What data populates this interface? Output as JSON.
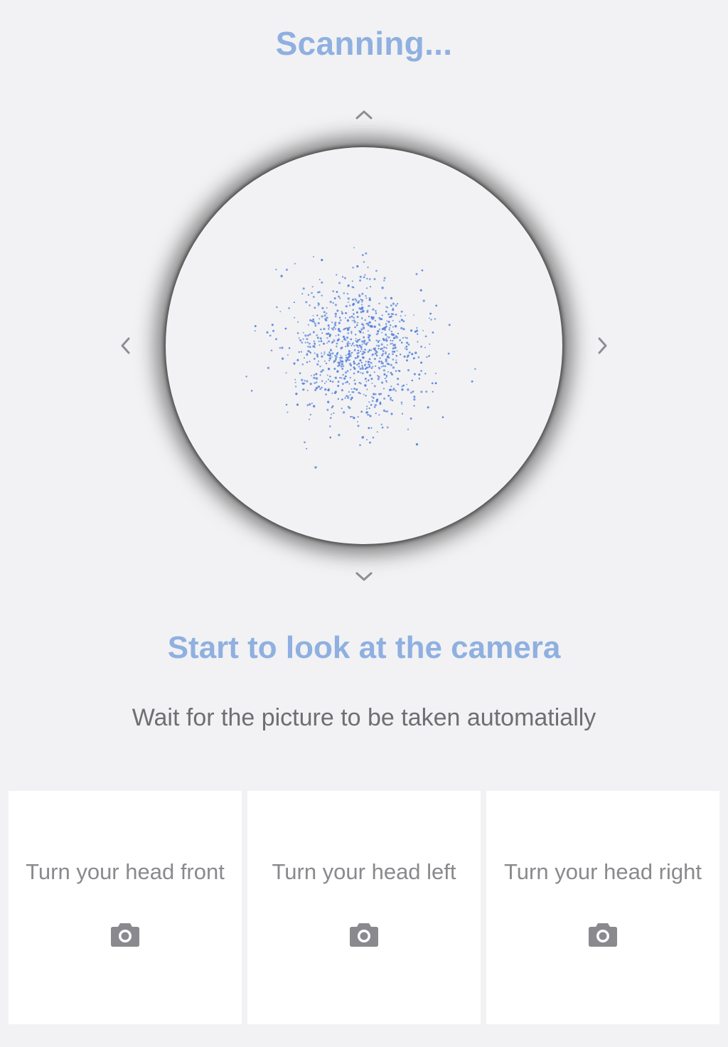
{
  "header": {
    "status": "Scanning..."
  },
  "scanner": {
    "arrow_up_icon": "chevron-up",
    "arrow_down_icon": "chevron-down",
    "arrow_left_icon": "chevron-left",
    "arrow_right_icon": "chevron-right",
    "dot_color": "#5b86dc"
  },
  "instruction": {
    "title": "Start to look at the camera",
    "subtitle": "Wait for the picture to be taken automatially"
  },
  "captures": [
    {
      "label": "Turn your head front",
      "icon": "camera-icon"
    },
    {
      "label": "Turn your head left",
      "icon": "camera-icon"
    },
    {
      "label": "Turn your head right",
      "icon": "camera-icon"
    }
  ],
  "colors": {
    "accent": "#8fb0e0",
    "background": "#f2f2f4",
    "card": "#ffffff",
    "muted_text": "#6f6f73",
    "icon": "#8a8a8e"
  }
}
